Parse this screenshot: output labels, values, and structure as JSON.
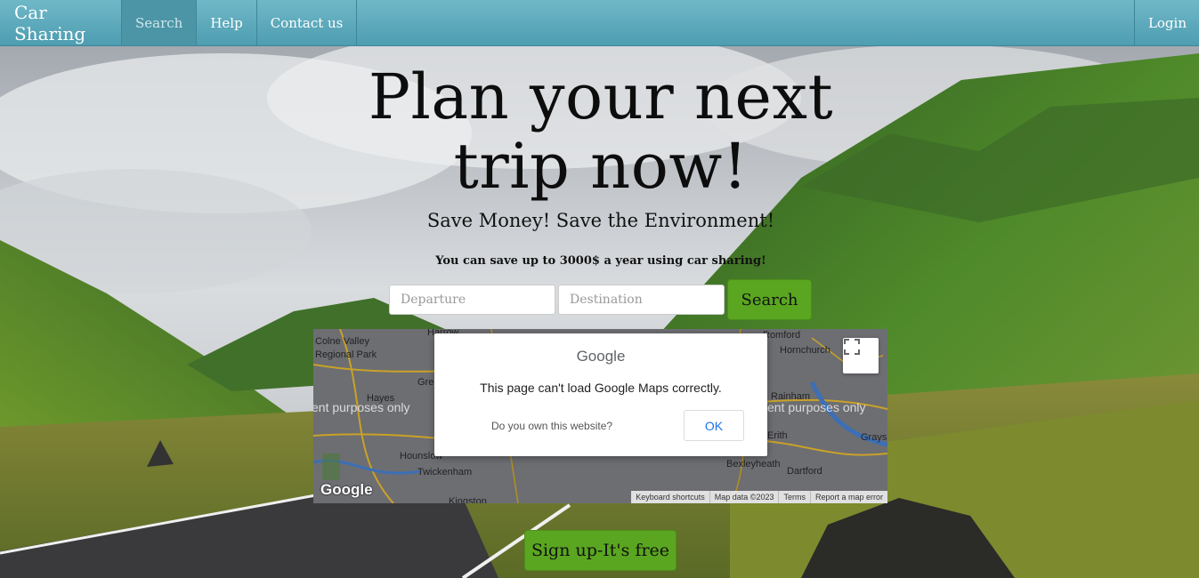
{
  "navbar": {
    "brand": "Car Sharing",
    "items": [
      {
        "label": "Search",
        "active": true
      },
      {
        "label": "Help",
        "active": false
      },
      {
        "label": "Contact us",
        "active": false
      }
    ],
    "login": "Login"
  },
  "hero": {
    "title": "Plan your next trip now!",
    "subtitle": "Save Money! Save the Environment!",
    "note": "You can save up to 3000$ a year using car sharing!"
  },
  "search_form": {
    "departure_placeholder": "Departure",
    "destination_placeholder": "Destination",
    "search_label": "Search"
  },
  "map": {
    "places": [
      "Colne Valley",
      "Regional Park",
      "Harrow",
      "Hayes",
      "Gre",
      "Hounslow",
      "Twickenham",
      "Kingston",
      "Romford",
      "Hornchurch",
      "Rainham",
      "Erith",
      "Grays",
      "Bexleyheath",
      "Dartford"
    ],
    "watermark_left": "ent purposes only",
    "watermark_right": "ent purposes only",
    "google_logo": "Google",
    "footer": [
      "Keyboard shortcuts",
      "Map data ©2023",
      "Terms",
      "Report a map error"
    ]
  },
  "dialog": {
    "logo": "Google",
    "message": "This page can't load Google Maps correctly.",
    "question": "Do you own this website?",
    "ok_label": "OK"
  },
  "signup": {
    "label": "Sign up-It's free"
  },
  "colors": {
    "navbar": "#5aaabd",
    "button_green": "#5aa620",
    "link_blue": "#1a73e8"
  }
}
